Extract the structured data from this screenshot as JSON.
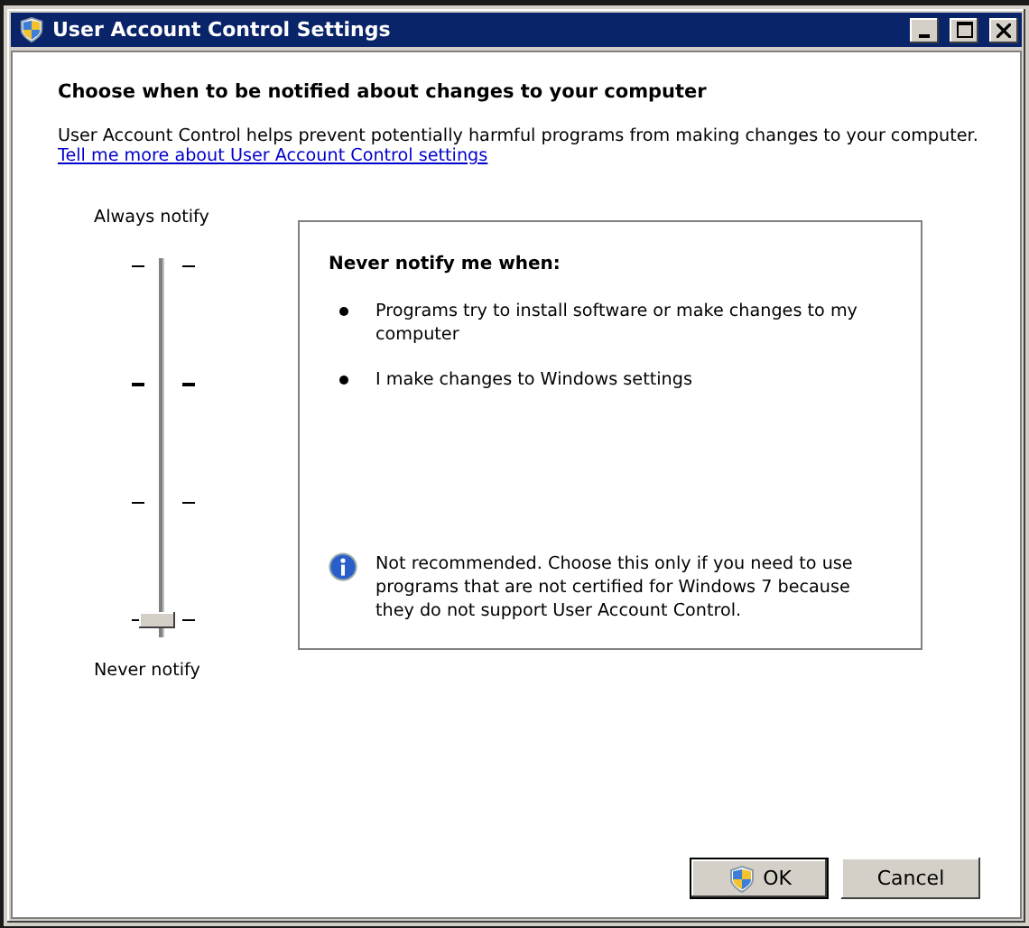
{
  "window": {
    "title": "User Account Control Settings"
  },
  "heading": "Choose when to be notified about changes to your computer",
  "description": "User Account Control helps prevent potentially harmful programs from making changes to your computer.",
  "link": "Tell me more about User Account Control settings",
  "slider": {
    "top_label": "Always notify",
    "bottom_label": "Never notify",
    "level": 0
  },
  "panel": {
    "title": "Never notify me when:",
    "bullets": [
      "Programs try to install software or make changes to my computer",
      "I make changes to Windows settings"
    ],
    "note": "Not recommended. Choose this only if you need to use programs that are not certified for Windows 7 because they do not support User Account Control."
  },
  "buttons": [
    {
      "label": "OK",
      "kind": "shield"
    },
    {
      "label": "Cancel",
      "kind": "plain"
    }
  ]
}
